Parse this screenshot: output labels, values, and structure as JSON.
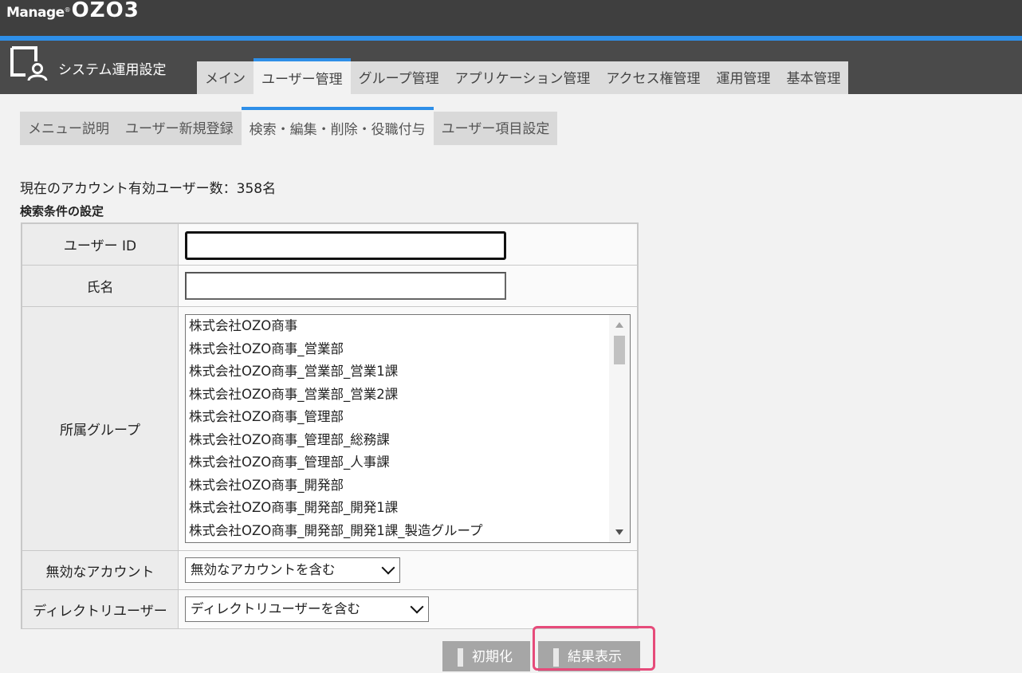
{
  "app": {
    "logo_prefix": "Manage",
    "logo_reg": "®",
    "logo_name": "OZO3",
    "section_title": "システム運用設定",
    "section_icon": "user-settings-icon"
  },
  "main_tabs": [
    {
      "label": "メイン",
      "active": false
    },
    {
      "label": "ユーザー管理",
      "active": true
    },
    {
      "label": "グループ管理",
      "active": false
    },
    {
      "label": "アプリケーション管理",
      "active": false
    },
    {
      "label": "アクセス権管理",
      "active": false
    },
    {
      "label": "運用管理",
      "active": false
    },
    {
      "label": "基本管理",
      "active": false
    }
  ],
  "sub_tabs": [
    {
      "label": "メニュー説明",
      "active": false
    },
    {
      "label": "ユーザー新規登録",
      "active": false
    },
    {
      "label": "検索・編集・削除・役職付与",
      "active": true
    },
    {
      "label": "ユーザー項目設定",
      "active": false
    }
  ],
  "status": {
    "active_users": "現在のアカウント有効ユーザー数：358名"
  },
  "search": {
    "title": "検索条件の設定",
    "user_id_label": "ユーザー ID",
    "user_id_value": "",
    "name_label": "氏名",
    "name_value": "",
    "group_label": "所属グループ",
    "groups": [
      "株式会社OZO商事",
      "株式会社OZO商事_営業部",
      "株式会社OZO商事_営業部_営業1課",
      "株式会社OZO商事_営業部_営業2課",
      "株式会社OZO商事_管理部",
      "株式会社OZO商事_管理部_総務課",
      "株式会社OZO商事_管理部_人事課",
      "株式会社OZO商事_開発部",
      "株式会社OZO商事_開発部_開発1課",
      "株式会社OZO商事_開発部_開発1課_製造グループ"
    ],
    "invalid_account_label": "無効なアカウント",
    "invalid_account_value": "無効なアカウントを含む",
    "directory_user_label": "ディレクトリユーザー",
    "directory_user_value": "ディレクトリユーザーを含む"
  },
  "buttons": {
    "reset": "初期化",
    "show_results": "結果表示"
  },
  "colors": {
    "accent": "#2e8fe8",
    "highlight": "#e64b7a",
    "button": "#a6a6a6"
  }
}
